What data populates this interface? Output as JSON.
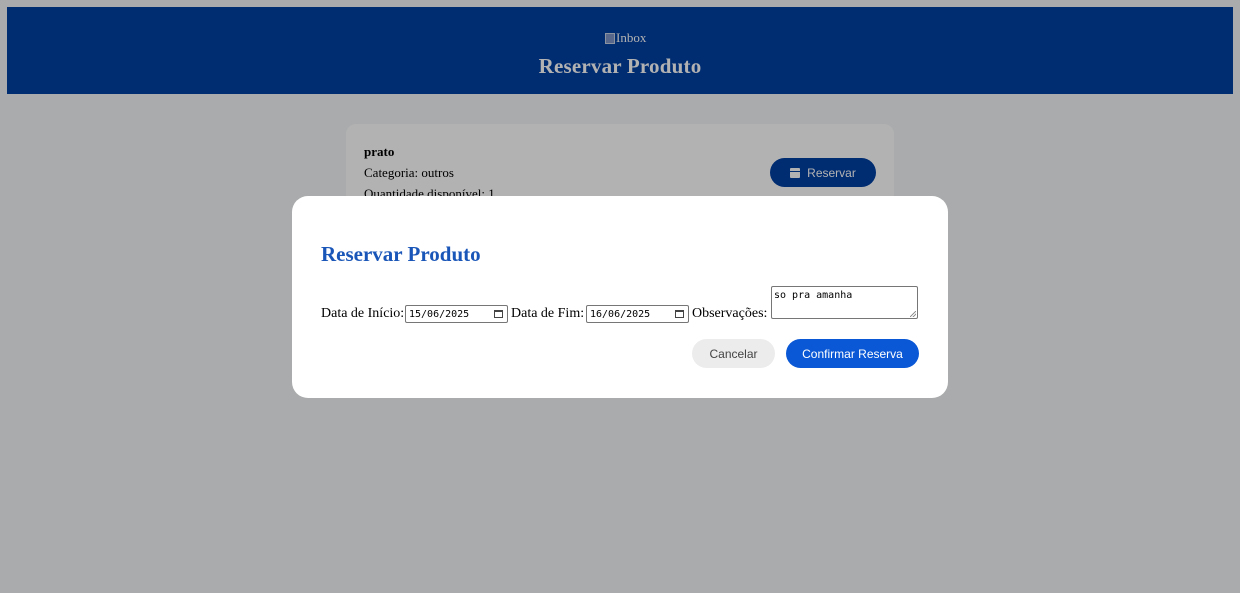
{
  "header": {
    "logo_alt": "Inbox",
    "title": "Reservar Produto"
  },
  "product_card": {
    "name": "prato",
    "category": "Categoria: outros",
    "quantity": "Quantidade disponível: 1",
    "reserve_button": "Reservar",
    "reserve_icon": "calendar-icon"
  },
  "modal": {
    "title": "Reservar Produto",
    "start_label": "Data de Início:",
    "start_value": "15/06/2025",
    "end_label": "Data de Fim:",
    "end_value": "16/06/2025",
    "notes_label": "Observações:",
    "notes_value": "so pra amanha",
    "cancel_button": "Cancelar",
    "confirm_button": "Confirmar Reserva"
  },
  "colors": {
    "header_bg": "#003fa3",
    "modal_title": "#1a56b8",
    "confirm_bg": "#0a58d6",
    "cancel_bg": "#ececec",
    "overlay": "rgba(0,0,0,0.3)"
  }
}
